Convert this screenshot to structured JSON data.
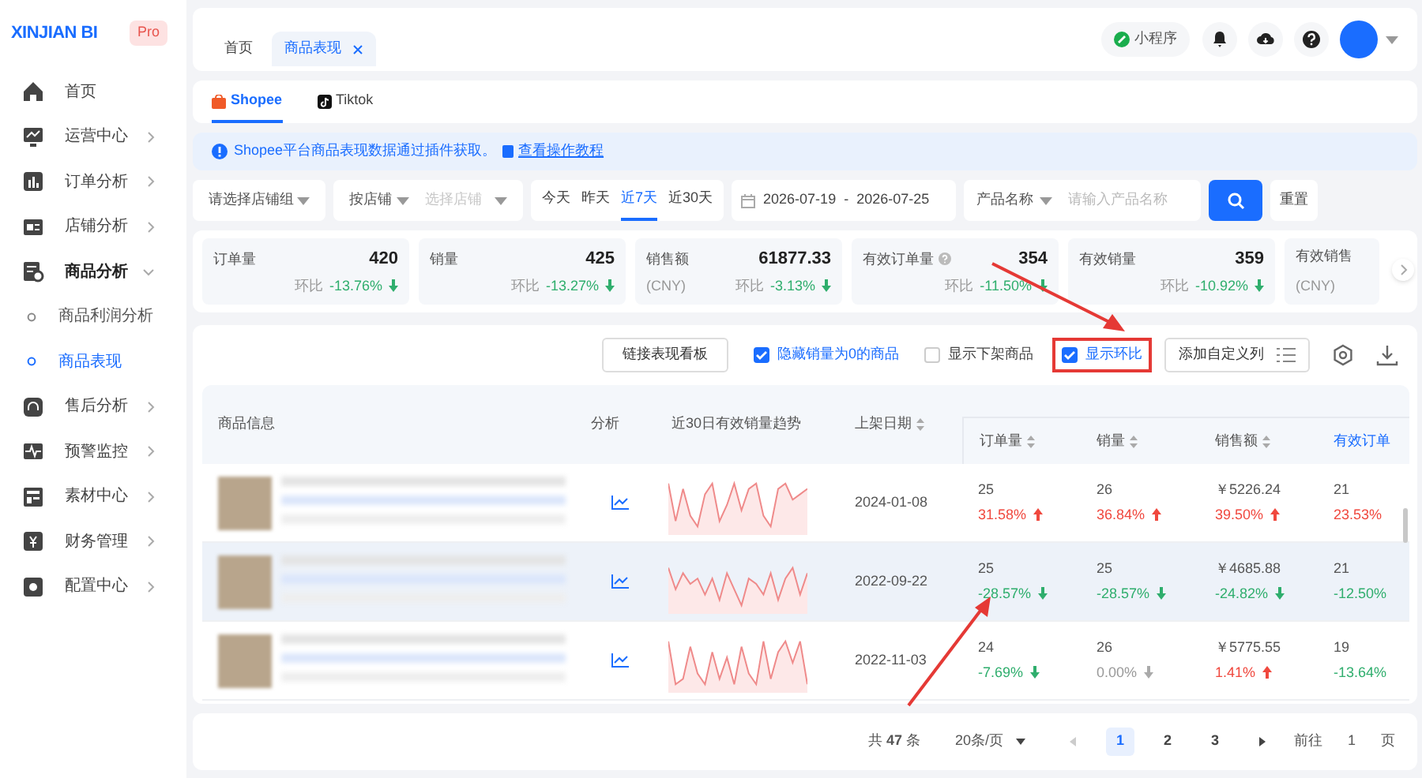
{
  "brand": {
    "name": "XINJIAN BI",
    "badge": "Pro"
  },
  "sidebar": {
    "items": [
      {
        "label": "首页",
        "kind": "link"
      },
      {
        "label": "运营中心",
        "kind": "group",
        "expanded": false
      },
      {
        "label": "订单分析",
        "kind": "group",
        "expanded": false
      },
      {
        "label": "店铺分析",
        "kind": "group",
        "expanded": false
      },
      {
        "label": "商品分析",
        "kind": "group",
        "expanded": true,
        "children": [
          {
            "label": "商品利润分析",
            "selected": false
          },
          {
            "label": "商品表现",
            "selected": true
          }
        ]
      },
      {
        "label": "售后分析",
        "kind": "group",
        "expanded": false
      },
      {
        "label": "预警监控",
        "kind": "group",
        "expanded": false
      },
      {
        "label": "素材中心",
        "kind": "group",
        "expanded": false
      },
      {
        "label": "财务管理",
        "kind": "group",
        "expanded": false
      },
      {
        "label": "配置中心",
        "kind": "group",
        "expanded": false
      }
    ]
  },
  "page_tabs": [
    {
      "label": "首页",
      "selected": false,
      "closable": false
    },
    {
      "label": "商品表现",
      "selected": true,
      "closable": true
    }
  ],
  "header": {
    "mini_program": "小程序"
  },
  "platform_tabs": [
    {
      "label": "Shopee",
      "selected": true
    },
    {
      "label": "Tiktok",
      "selected": false
    }
  ],
  "notice": {
    "text": "Shopee平台商品表现数据通过插件获取。",
    "link": "查看操作教程"
  },
  "filters": {
    "shop_group": {
      "placeholder": "请选择店铺组"
    },
    "shop_mode": {
      "value": "按店铺"
    },
    "shop": {
      "placeholder": "选择店铺"
    },
    "quick_ranges": [
      {
        "label": "今天",
        "selected": false
      },
      {
        "label": "昨天",
        "selected": false
      },
      {
        "label": "近7天",
        "selected": true
      },
      {
        "label": "近30天",
        "selected": false
      }
    ],
    "date_start": "2026-07-19",
    "date_separator": "-",
    "date_end": "2026-07-25",
    "search_field": {
      "value": "产品名称"
    },
    "search_input": {
      "placeholder": "请输入产品名称"
    },
    "reset": "重置"
  },
  "metrics": [
    {
      "label": "订单量",
      "value": "420",
      "compare_label": "环比",
      "change": "-13.76%",
      "kind": "down",
      "info": false
    },
    {
      "label": "销量",
      "value": "425",
      "compare_label": "环比",
      "change": "-13.27%",
      "kind": "down",
      "info": false
    },
    {
      "label": "销售额",
      "value": "61877.33",
      "sub": "(CNY)",
      "compare_label": "环比",
      "change": "-3.13%",
      "kind": "down",
      "info": false
    },
    {
      "label": "有效订单量",
      "value": "354",
      "compare_label": "环比",
      "change": "-11.50%",
      "kind": "down",
      "info": true
    },
    {
      "label": "有效销量",
      "value": "359",
      "compare_label": "环比",
      "change": "-10.92%",
      "kind": "down",
      "info": false
    },
    {
      "label": "有效销售",
      "sub": "(CNY)",
      "info": false
    }
  ],
  "toolbar": {
    "link_board": "链接表现看板",
    "options": [
      {
        "label": "隐藏销量为0的商品",
        "checked": true,
        "highlighted": false
      },
      {
        "label": "显示下架商品",
        "checked": false,
        "highlighted": false
      },
      {
        "label": "显示环比",
        "checked": true,
        "highlighted": true
      }
    ],
    "custom_columns": "添加自定义列"
  },
  "table": {
    "columns": [
      {
        "label": "商品信息",
        "sortable": false,
        "accent": false
      },
      {
        "label": "分析",
        "sortable": false,
        "accent": false
      },
      {
        "label": "近30日有效销量趋势",
        "sortable": false,
        "accent": false
      },
      {
        "label": "上架日期",
        "sortable": true,
        "accent": false
      },
      {
        "label": "订单量",
        "sortable": true,
        "accent": false
      },
      {
        "label": "销量",
        "sortable": true,
        "accent": false
      },
      {
        "label": "销售额",
        "sortable": true,
        "accent": false
      },
      {
        "label": "有效订单",
        "sortable": false,
        "accent": true
      }
    ],
    "rows": [
      {
        "date": "2024-01-08",
        "highlighted": false,
        "cells": [
          {
            "value": "25",
            "change": "31.58%",
            "kind": "up"
          },
          {
            "value": "26",
            "change": "36.84%",
            "kind": "up"
          },
          {
            "value": "￥5226.24",
            "change": "39.50%",
            "kind": "up"
          },
          {
            "value": "21",
            "change": "23.53%",
            "kind": "up"
          }
        ]
      },
      {
        "date": "2022-09-22",
        "highlighted": true,
        "cells": [
          {
            "value": "25",
            "change": "-28.57%",
            "kind": "down"
          },
          {
            "value": "25",
            "change": "-28.57%",
            "kind": "down"
          },
          {
            "value": "￥4685.88",
            "change": "-24.82%",
            "kind": "down"
          },
          {
            "value": "21",
            "change": "-12.50%",
            "kind": "down"
          }
        ]
      },
      {
        "date": "2022-11-03",
        "highlighted": false,
        "cells": [
          {
            "value": "24",
            "change": "-7.69%",
            "kind": "down"
          },
          {
            "value": "26",
            "change": "0.00%",
            "kind": "flat"
          },
          {
            "value": "￥5775.55",
            "change": "1.41%",
            "kind": "up"
          },
          {
            "value": "19",
            "change": "-13.64%",
            "kind": "down"
          }
        ]
      }
    ]
  },
  "pagination": {
    "total": "共 **47** 条",
    "page_size": "20条/页",
    "pages": [
      {
        "label": "1",
        "selected": true
      },
      {
        "label": "2",
        "selected": false
      },
      {
        "label": "3",
        "selected": false
      }
    ],
    "goto_label": "前往",
    "goto_value": "1",
    "page_unit": "页"
  }
}
